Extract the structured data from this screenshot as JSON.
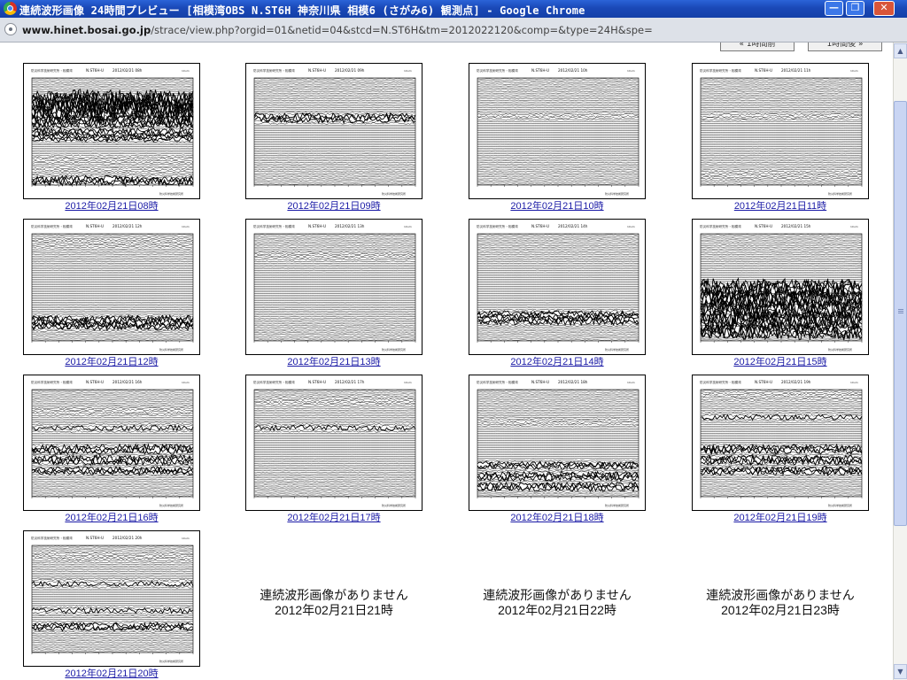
{
  "window": {
    "title": "連続波形画像 24時間プレビュー [相模湾OBS  N.ST6H  神奈川県 相模6 (さがみ6) 観測点] - Google Chrome",
    "minimize": "—",
    "maximize": "❐",
    "close": "✕"
  },
  "address": {
    "host": "www.hinet.bosai.go.jp",
    "path": "/strace/view.php?orgid=01&netid=04&stcd=N.ST6H&tm=2012022120&comp=&type=24H&spe="
  },
  "nav": {
    "prev_label": "« 1時間前",
    "next_label": "1時間後 »"
  },
  "thumb_header": {
    "org": "防災科学技術研究所・相模湾",
    "station": "N.ST6H-U",
    "footer": "防災科学技術研究所",
    "unit": "10um"
  },
  "thumbnails": [
    {
      "caption": "2012年02月21日08時",
      "plot_title": "2012/02/21 08h",
      "activity": [
        {
          "at": 0.2,
          "amp": 0.95
        },
        {
          "at": 0.25,
          "amp": 1.0
        },
        {
          "at": 0.3,
          "amp": 0.95
        },
        {
          "at": 0.4,
          "amp": 0.5
        },
        {
          "at": 0.5,
          "amp": 0.3
        },
        {
          "at": 0.55,
          "amp": 0.25
        },
        {
          "at": 0.75,
          "amp": 0.12
        },
        {
          "at": 0.85,
          "amp": 0.1
        },
        {
          "at": 0.95,
          "amp": 0.35
        }
      ]
    },
    {
      "caption": "2012年02月21日09時",
      "plot_title": "2012/02/21 09h",
      "activity": [
        {
          "at": 0.36,
          "amp": 0.3
        },
        {
          "at": 0.38,
          "amp": 0.25
        }
      ]
    },
    {
      "caption": "2012年02月21日10時",
      "plot_title": "2012/02/21 10h",
      "activity": [
        {
          "at": 0.35,
          "amp": 0.12
        }
      ]
    },
    {
      "caption": "2012年02月21日11時",
      "plot_title": "2012/02/21 11h",
      "activity": [
        {
          "at": 0.35,
          "amp": 0.14
        },
        {
          "at": 0.9,
          "amp": 0.12
        }
      ]
    },
    {
      "caption": "2012年02月21日12時",
      "plot_title": "2012/02/21 12h",
      "activity": [
        {
          "at": 0.08,
          "amp": 0.12
        },
        {
          "at": 0.8,
          "amp": 0.35
        },
        {
          "at": 0.85,
          "amp": 0.3
        }
      ]
    },
    {
      "caption": "2012年02月21日13時",
      "plot_title": "2012/02/21 13h",
      "activity": [
        {
          "at": 0.2,
          "amp": 0.12
        }
      ]
    },
    {
      "caption": "2012年02月21日14時",
      "plot_title": "2012/02/21 14h",
      "activity": [
        {
          "at": 0.75,
          "amp": 0.25
        },
        {
          "at": 0.8,
          "amp": 0.3
        }
      ]
    },
    {
      "caption": "2012年02月21日15時",
      "plot_title": "2012/02/21 15h",
      "activity": [
        {
          "at": 0.5,
          "amp": 0.8
        },
        {
          "at": 0.6,
          "amp": 0.9
        },
        {
          "at": 0.7,
          "amp": 0.9
        },
        {
          "at": 0.8,
          "amp": 0.85
        },
        {
          "at": 0.9,
          "amp": 0.7
        }
      ]
    },
    {
      "caption": "2012年02月21日16時",
      "plot_title": "2012/02/21 16h",
      "activity": [
        {
          "at": 0.2,
          "amp": 0.15
        },
        {
          "at": 0.35,
          "amp": 0.2
        },
        {
          "at": 0.55,
          "amp": 0.35
        },
        {
          "at": 0.65,
          "amp": 0.35
        },
        {
          "at": 0.75,
          "amp": 0.25
        }
      ]
    },
    {
      "caption": "2012年02月21日17時",
      "plot_title": "2012/02/21 17h",
      "activity": [
        {
          "at": 0.1,
          "amp": 0.15
        },
        {
          "at": 0.35,
          "amp": 0.2
        }
      ]
    },
    {
      "caption": "2012年02月21日18時",
      "plot_title": "2012/02/21 18h",
      "activity": [
        {
          "at": 0.3,
          "amp": 0.12
        },
        {
          "at": 0.7,
          "amp": 0.25
        },
        {
          "at": 0.8,
          "amp": 0.35
        },
        {
          "at": 0.9,
          "amp": 0.3
        }
      ]
    },
    {
      "caption": "2012年02月21日19時",
      "plot_title": "2012/02/21 19h",
      "activity": [
        {
          "at": 0.05,
          "amp": 0.15
        },
        {
          "at": 0.25,
          "amp": 0.2
        },
        {
          "at": 0.55,
          "amp": 0.35
        },
        {
          "at": 0.65,
          "amp": 0.35
        },
        {
          "at": 0.75,
          "amp": 0.3
        }
      ]
    },
    {
      "caption": "2012年02月21日20時",
      "plot_title": "2012/02/21 20h",
      "activity": [
        {
          "at": 0.1,
          "amp": 0.15
        },
        {
          "at": 0.35,
          "amp": 0.2
        },
        {
          "at": 0.6,
          "amp": 0.2
        },
        {
          "at": 0.75,
          "amp": 0.25
        }
      ]
    }
  ],
  "missing": [
    {
      "message": "連続波形画像がありません",
      "time": "2012年02月21日21時"
    },
    {
      "message": "連続波形画像がありません",
      "time": "2012年02月21日22時"
    },
    {
      "message": "連続波形画像がありません",
      "time": "2012年02月21日23時"
    }
  ],
  "colors": {
    "link": "#1a1aa6",
    "frame": "#000000",
    "trace": "#000000"
  }
}
